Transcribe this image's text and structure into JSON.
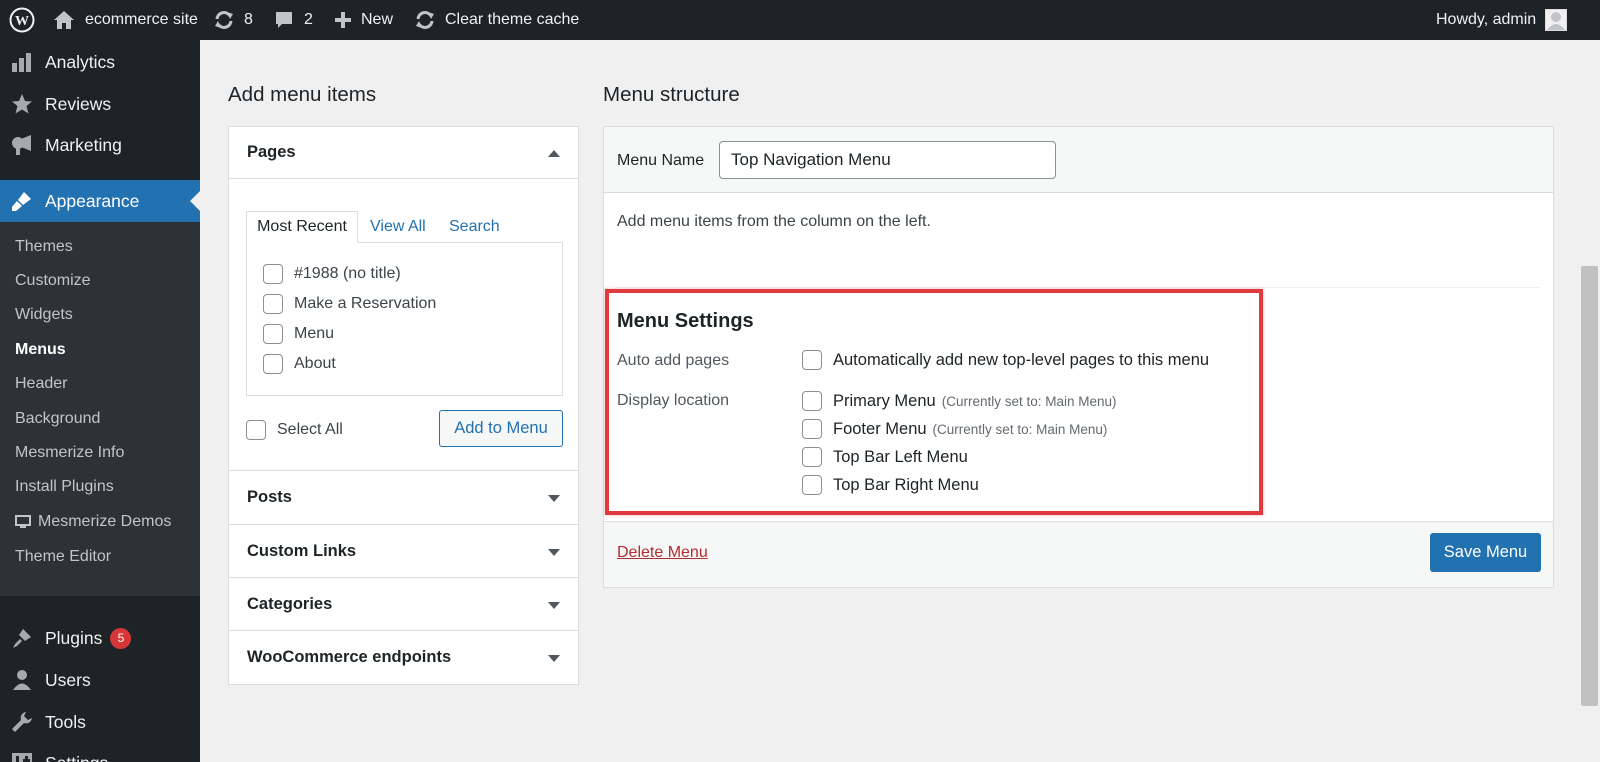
{
  "admin_bar": {
    "site_name": "ecommerce site",
    "updates_count": "8",
    "comments_count": "2",
    "new_label": "New",
    "clear_cache_label": "Clear theme cache",
    "greeting": "Howdy, admin",
    "icons": [
      "wordpress-logo-icon",
      "home-icon",
      "updates-icon",
      "comment-icon",
      "plus-icon",
      "refresh-icon",
      "avatar-icon"
    ]
  },
  "sidebar": {
    "items_top": [
      {
        "label": "Analytics",
        "icon": "analytics-icon"
      },
      {
        "label": "Reviews",
        "icon": "star-icon"
      },
      {
        "label": "Marketing",
        "icon": "megaphone-icon"
      }
    ],
    "current": {
      "label": "Appearance",
      "icon": "brush-icon"
    },
    "submenu": [
      {
        "label": "Themes"
      },
      {
        "label": "Customize"
      },
      {
        "label": "Widgets"
      },
      {
        "label": "Menus",
        "active": true
      },
      {
        "label": "Header"
      },
      {
        "label": "Background"
      },
      {
        "label": "Mesmerize Info"
      },
      {
        "label": "Install Plugins"
      },
      {
        "label": "Mesmerize Demos",
        "icon": "monitor-icon"
      },
      {
        "label": "Theme Editor"
      }
    ],
    "items_bottom": [
      {
        "label": "Plugins",
        "icon": "plugin-icon",
        "badge": "5"
      },
      {
        "label": "Users",
        "icon": "users-icon"
      },
      {
        "label": "Tools",
        "icon": "wrench-icon"
      },
      {
        "label": "Settings",
        "icon": "settings-icon"
      }
    ]
  },
  "add_menu_items": {
    "heading": "Add menu items",
    "pages": {
      "title": "Pages",
      "tabs": [
        "Most Recent",
        "View All",
        "Search"
      ],
      "items": [
        "#1988 (no title)",
        "Make a Reservation",
        "Menu",
        "About"
      ],
      "select_all": "Select All",
      "add_button": "Add to Menu"
    },
    "sections": [
      "Posts",
      "Custom Links",
      "Categories",
      "WooCommerce endpoints"
    ]
  },
  "menu_structure": {
    "heading": "Menu structure",
    "menu_name_label": "Menu Name",
    "menu_name_value": "Top Navigation Menu",
    "instructions": "Add menu items from the column on the left.",
    "settings": {
      "title": "Menu Settings",
      "auto_add_label": "Auto add pages",
      "auto_add_option": "Automatically add new top-level pages to this menu",
      "display_location_label": "Display location",
      "locations": [
        {
          "name": "Primary Menu",
          "note": "(Currently set to: Main Menu)"
        },
        {
          "name": "Footer Menu",
          "note": "(Currently set to: Main Menu)"
        },
        {
          "name": "Top Bar Left Menu",
          "note": ""
        },
        {
          "name": "Top Bar Right Menu",
          "note": ""
        }
      ]
    },
    "delete_link": "Delete Menu",
    "save_button": "Save Menu"
  },
  "colors": {
    "admin_dark": "#1d2327",
    "accent_blue": "#2271b1",
    "highlight_red": "#e0393e",
    "badge_red": "#d63638"
  }
}
